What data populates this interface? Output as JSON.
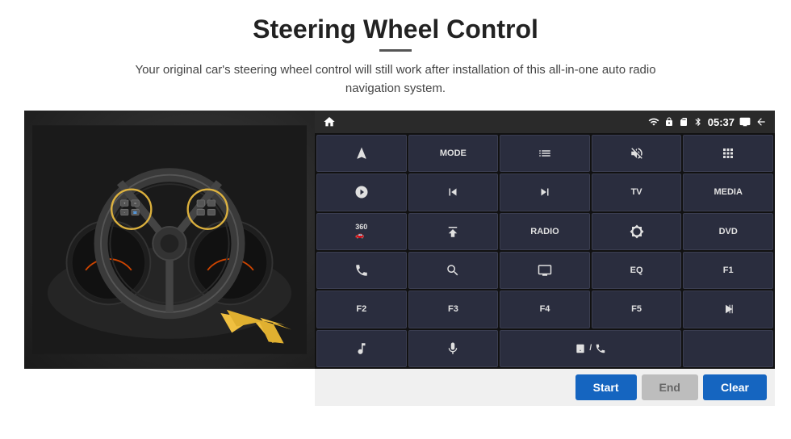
{
  "page": {
    "title": "Steering Wheel Control",
    "subtitle": "Your original car's steering wheel control will still work after installation of this all-in-one auto radio navigation system."
  },
  "status_bar": {
    "time": "05:37"
  },
  "grid_buttons": [
    {
      "id": "b1",
      "label": "",
      "icon": "navigate",
      "row": 1,
      "col": 1
    },
    {
      "id": "b2",
      "label": "MODE",
      "icon": "",
      "row": 1,
      "col": 2
    },
    {
      "id": "b3",
      "label": "",
      "icon": "list",
      "row": 1,
      "col": 3
    },
    {
      "id": "b4",
      "label": "",
      "icon": "mute",
      "row": 1,
      "col": 4
    },
    {
      "id": "b5",
      "label": "",
      "icon": "apps",
      "row": 1,
      "col": 5
    },
    {
      "id": "b6",
      "label": "",
      "icon": "settings-circle",
      "row": 2,
      "col": 1
    },
    {
      "id": "b7",
      "label": "",
      "icon": "prev",
      "row": 2,
      "col": 2
    },
    {
      "id": "b8",
      "label": "",
      "icon": "next",
      "row": 2,
      "col": 3
    },
    {
      "id": "b9",
      "label": "TV",
      "icon": "",
      "row": 2,
      "col": 4
    },
    {
      "id": "b10",
      "label": "MEDIA",
      "icon": "",
      "row": 2,
      "col": 5
    },
    {
      "id": "b11",
      "label": "",
      "icon": "360-car",
      "row": 3,
      "col": 1
    },
    {
      "id": "b12",
      "label": "",
      "icon": "eject",
      "row": 3,
      "col": 2
    },
    {
      "id": "b13",
      "label": "RADIO",
      "icon": "",
      "row": 3,
      "col": 3
    },
    {
      "id": "b14",
      "label": "",
      "icon": "brightness",
      "row": 3,
      "col": 4
    },
    {
      "id": "b15",
      "label": "DVD",
      "icon": "",
      "row": 3,
      "col": 5
    },
    {
      "id": "b16",
      "label": "",
      "icon": "phone",
      "row": 4,
      "col": 1
    },
    {
      "id": "b17",
      "label": "",
      "icon": "search",
      "row": 4,
      "col": 2
    },
    {
      "id": "b18",
      "label": "",
      "icon": "screen",
      "row": 4,
      "col": 3
    },
    {
      "id": "b19",
      "label": "EQ",
      "icon": "",
      "row": 4,
      "col": 4
    },
    {
      "id": "b20",
      "label": "F1",
      "icon": "",
      "row": 4,
      "col": 5
    },
    {
      "id": "b21",
      "label": "F2",
      "icon": "",
      "row": 5,
      "col": 1
    },
    {
      "id": "b22",
      "label": "F3",
      "icon": "",
      "row": 5,
      "col": 2
    },
    {
      "id": "b23",
      "label": "F4",
      "icon": "",
      "row": 5,
      "col": 3
    },
    {
      "id": "b24",
      "label": "F5",
      "icon": "",
      "row": 5,
      "col": 4
    },
    {
      "id": "b25",
      "label": "",
      "icon": "play-pause",
      "row": 5,
      "col": 5
    },
    {
      "id": "b26",
      "label": "",
      "icon": "music",
      "row": 6,
      "col": 1
    },
    {
      "id": "b27",
      "label": "",
      "icon": "mic",
      "row": 6,
      "col": 2
    },
    {
      "id": "b28",
      "label": "",
      "icon": "vol-phone",
      "row": 6,
      "col": 3,
      "span": 2
    },
    {
      "id": "b29",
      "label": "",
      "icon": "",
      "row": 6,
      "col": 4
    },
    {
      "id": "b30",
      "label": "",
      "icon": "",
      "row": 6,
      "col": 5
    }
  ],
  "action_buttons": {
    "start": "Start",
    "end": "End",
    "clear": "Clear"
  }
}
